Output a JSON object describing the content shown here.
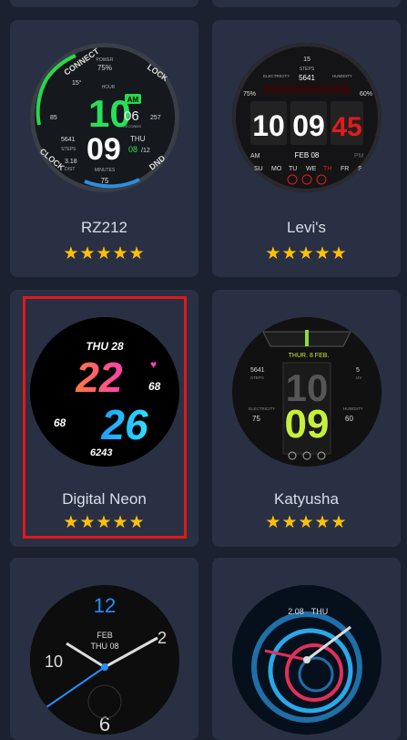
{
  "watchfaces": [
    {
      "name": "RZ212",
      "rating": "★★★★★",
      "face": {
        "connect": "CONNECT",
        "lock": "LOCK",
        "clock": "CLOCK",
        "dnd": "DND",
        "power_label": "POWER",
        "power": "75%",
        "temp": "15°",
        "hour_label": "HOUR",
        "ampm": "AM",
        "hour": "10",
        "minute": "09",
        "seconds": "06",
        "seconds_label": "SECONDS",
        "weekday": "THU",
        "day": "08",
        "date_suffix": "/12",
        "calorie": "257",
        "calorie_unit": "kcal",
        "calorie_label": "CALORIE",
        "heart_label": "HEART RATE",
        "heart": "85",
        "steps": "5641",
        "steps_label": "STEPS",
        "dist": "3.18",
        "dist_label": "DIST",
        "minutes_label": "MINUTES",
        "brand": "RZ212",
        "pai": "75",
        "pai_label": "PAI"
      }
    },
    {
      "name": "Levi's",
      "rating": "★★★★★",
      "face": {
        "top_num": "15",
        "steps_label": "STEPS",
        "steps": "5641",
        "elec_label": "ELECTRICITY",
        "hum_label": "HUMIDITY",
        "elec": "75%",
        "hum": "60%",
        "hour": "10",
        "minute": "09",
        "seconds": "45",
        "am": "AM",
        "pm": "PM",
        "date": "FEB 08",
        "days": [
          "SU",
          "MO",
          "TU",
          "WE",
          "TH",
          "FR",
          "SA"
        ]
      }
    },
    {
      "name": "Digital Neon",
      "rating": "★★★★★",
      "face": {
        "day": "THU 28",
        "hour": "22",
        "minute": "26",
        "heart": "68",
        "battery": "68",
        "steps": "6243"
      }
    },
    {
      "name": "Katyusha",
      "rating": "★★★★★",
      "face": {
        "date": "THUR. 8 FEB.",
        "hour": "10",
        "minute": "09",
        "steps": "5641",
        "steps_label": "STEPS",
        "uv": "5",
        "uv_label": "UV",
        "elec_label": "ELECTRICITY",
        "elec": "75",
        "hum_label": "HUMIDITY",
        "hum": "60"
      }
    },
    {
      "name": "",
      "rating": "",
      "face": {
        "n12": "12",
        "n2": "2",
        "n10": "10",
        "n6": "6",
        "month": "FEB",
        "date": "THU 08"
      }
    },
    {
      "name": "",
      "rating": "",
      "face": {
        "date": "2.08",
        "day": "THU"
      }
    }
  ],
  "selected_index": 2,
  "colors": {
    "background": "#1c2131",
    "card": "#2a3043",
    "star": "#ffc107",
    "highlight": "#e01818"
  }
}
